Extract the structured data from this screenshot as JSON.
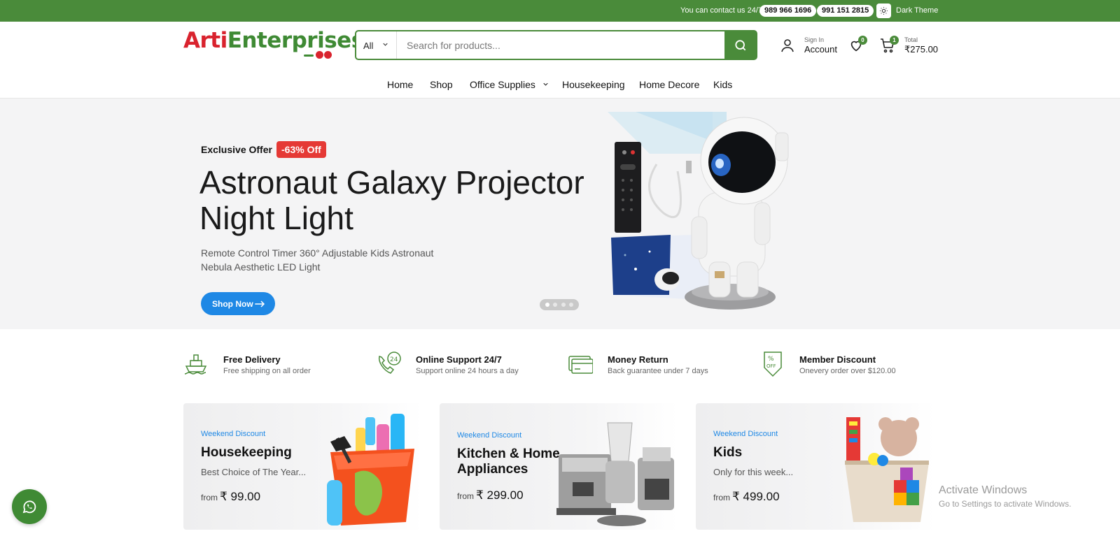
{
  "topbar": {
    "contact_text": "You can contact us 24/7",
    "phones": [
      "989 966 1696",
      "991 151 2815"
    ],
    "theme_label": "Dark Theme",
    "bg_color": "#4a8b3a"
  },
  "header": {
    "logo_part1": "Arti",
    "logo_part2": "Enterprises",
    "search": {
      "category": "All",
      "placeholder": "Search for products..."
    },
    "account": {
      "small": "Sign In",
      "label": "Account"
    },
    "wishlist_count": "0",
    "cart": {
      "count": "1",
      "small": "Total",
      "total": "₹275.00"
    }
  },
  "nav": {
    "items": [
      "Home",
      "Shop",
      "Office Supplies",
      "Housekeeping",
      "Home Decore",
      "Kids"
    ]
  },
  "hero": {
    "offer_label": "Exclusive Offer",
    "discount": "-63% Off",
    "title": "Astronaut Galaxy Projector Night Light",
    "description": "Remote Control Timer 360° Adjustable Kids Astronaut Nebula Aesthetic LED Light",
    "button": "Shop Now",
    "slides_total": 4,
    "active_slide": 1
  },
  "features": [
    {
      "title": "Free Delivery",
      "sub": "Free shipping on all order",
      "icon": "ship-icon"
    },
    {
      "title": "Online Support 24/7",
      "sub": "Support online 24 hours a day",
      "icon": "support-24-icon"
    },
    {
      "title": "Money Return",
      "sub": "Back guarantee under 7 days",
      "icon": "money-card-icon"
    },
    {
      "title": "Member Discount",
      "sub": "Onevery order over $120.00",
      "icon": "discount-tag-icon"
    }
  ],
  "cards": [
    {
      "tag": "Weekend Discount",
      "title": "Housekeeping",
      "sub": "Best Choice of The Year...",
      "from": "from",
      "price": "₹ 99.00"
    },
    {
      "tag": "Weekend Discount",
      "title": "Kitchen & Home Appliances",
      "sub": "",
      "from": "from",
      "price": "₹ 299.00"
    },
    {
      "tag": "Weekend Discount",
      "title": "Kids",
      "sub": "Only for this week...",
      "from": "from",
      "price": "₹ 499.00"
    }
  ],
  "watermark": {
    "line1": "Activate Windows",
    "line2": "Go to Settings to activate Windows."
  },
  "colors": {
    "brand_green": "#4a8b3a",
    "brand_red": "#d9232e",
    "accent_blue": "#1e88e5"
  }
}
